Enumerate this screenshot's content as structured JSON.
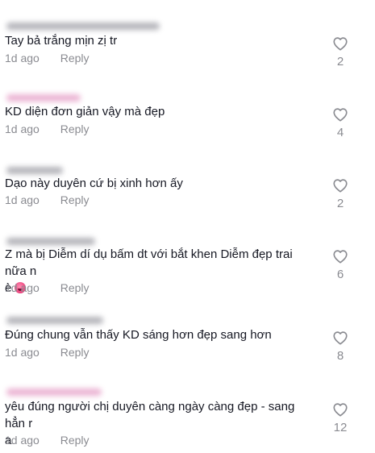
{
  "comments": [
    {
      "text": "Tay bả trắng mịn zị tr",
      "time": "1d ago",
      "reply": "Reply",
      "likes": "2",
      "username_tint": "gray"
    },
    {
      "text": "KD diện đơn giản vậy mà đẹp",
      "time": "1d ago",
      "reply": "Reply",
      "likes": "4",
      "username_tint": "pink"
    },
    {
      "text": "Dạo này duyên cứ bị xinh hơn ấy",
      "time": "1d ago",
      "reply": "Reply",
      "likes": "2",
      "username_tint": "gray"
    },
    {
      "text": "Z mà bị Diễm dí dụ bấm dt với bắt khen Diễm đẹp trai nữa n\nè",
      "emoji": "blushing-face-emoji",
      "time": "1d ago",
      "reply": "Reply",
      "likes": "6",
      "username_tint": "gray"
    },
    {
      "text": "Đúng chung vẫn thấy KD sáng hơn đẹp sang hơn",
      "time": "1d ago",
      "reply": "Reply",
      "likes": "8",
      "username_tint": "gray"
    },
    {
      "text": "yêu đúng người chị duyên càng ngày càng đẹp - sang hẳn r\na",
      "time": "1d ago",
      "reply": "Reply",
      "likes": "12",
      "username_tint": "pink"
    }
  ],
  "icons": {
    "like": "heart-outline-icon"
  },
  "colors": {
    "text": "#161823",
    "secondary": "#8a8b91",
    "icon": "#8a8b91"
  }
}
